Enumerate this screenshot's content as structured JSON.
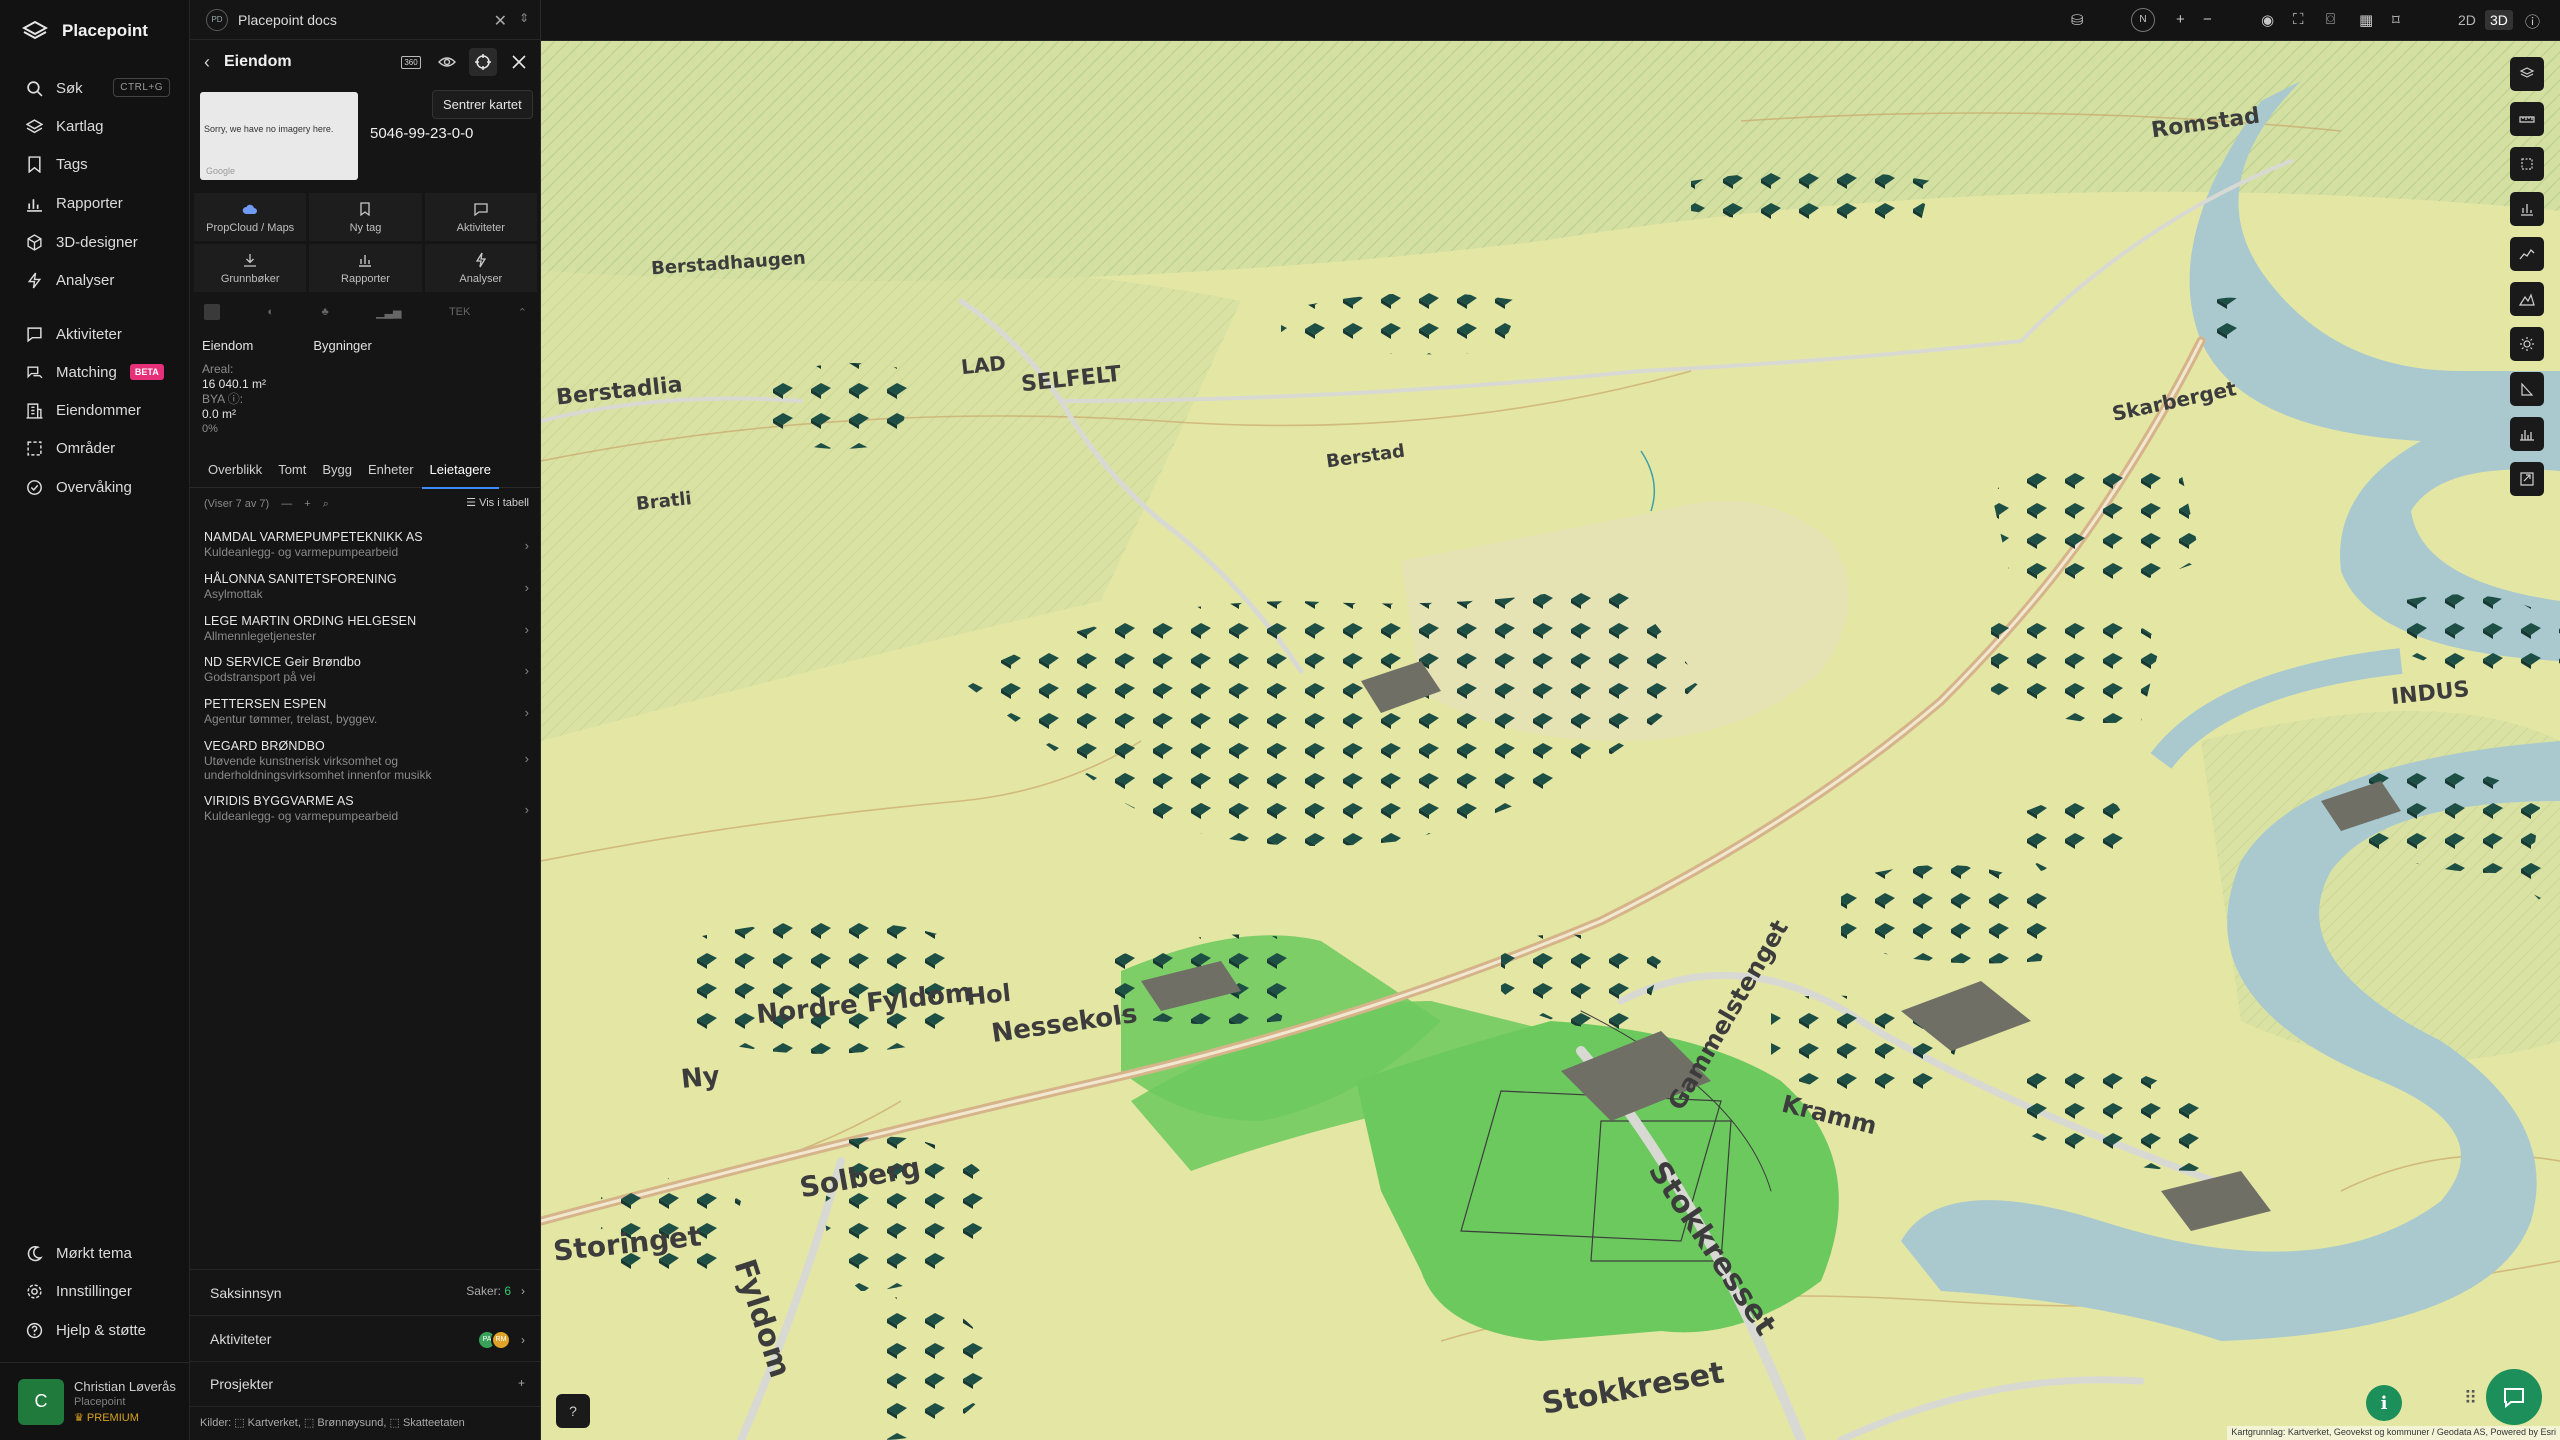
{
  "app": {
    "name": "Placepoint",
    "doc_tab": "Placepoint docs",
    "doc_tab_initials": "PD"
  },
  "nav": {
    "items": [
      {
        "label": "Søk",
        "shortcut": "CTRL+G"
      },
      {
        "label": "Kartlag"
      },
      {
        "label": "Tags"
      },
      {
        "label": "Rapporter"
      },
      {
        "label": "3D-designer"
      },
      {
        "label": "Analyser"
      },
      {
        "label": "Aktiviteter"
      },
      {
        "label": "Matching",
        "badge": "BETA"
      },
      {
        "label": "Eiendommer"
      },
      {
        "label": "Områder"
      },
      {
        "label": "Overvåking"
      }
    ],
    "bottom": [
      {
        "label": "Mørkt tema"
      },
      {
        "label": "Innstillinger"
      },
      {
        "label": "Hjelp & støtte"
      }
    ],
    "user": {
      "initial": "C",
      "name": "Christian Løverås",
      "org": "Placepoint",
      "plan": "PREMIUM"
    }
  },
  "panel": {
    "title": "Eiendom",
    "header_badge": "360",
    "tooltip": "Sentrer kartet",
    "thumb_message": "Sorry, we have no imagery here.",
    "thumb_credit": "Google",
    "parcel_id": "5046-99-23-0-0",
    "actions": [
      {
        "label": "PropCloud / Maps",
        "icon": "cloud-icon"
      },
      {
        "label": "Ny tag",
        "icon": "bookmark-icon"
      },
      {
        "label": "Aktiviteter",
        "icon": "chat-icon"
      },
      {
        "label": "Grunnbøker",
        "icon": "download-icon"
      },
      {
        "label": "Rapporter",
        "icon": "chart-icon"
      },
      {
        "label": "Analyser",
        "icon": "bolt-icon"
      }
    ],
    "layer_icon_text": "TEK",
    "subtabs": [
      "Eiendom",
      "Bygninger"
    ],
    "facts": {
      "area_label": "Areal:",
      "area_value": "16 040.1 m²",
      "bya_label": "BYA ⓘ:",
      "bya_value": "0.0 m²",
      "bya_pct": "0%"
    },
    "tabs": [
      "Overblikk",
      "Tomt",
      "Bygg",
      "Enheter",
      "Leietagere"
    ],
    "active_tab": "Leietagere",
    "list_count": "(Viser 7 av 7)",
    "list_table_btn": "Vis i tabell",
    "tenants": [
      {
        "name": "NAMDAL VARMEPUMPETEKNIKK AS",
        "desc": "Kuldeanlegg- og varmepumpearbeid"
      },
      {
        "name": "HÅLONNA SANITETSFORENING",
        "desc": "Asylmottak"
      },
      {
        "name": "LEGE MARTIN ORDING HELGESEN",
        "desc": "Allmennlegetjenester"
      },
      {
        "name": "ND SERVICE Geir Brøndbo",
        "desc": "Godstransport på vei"
      },
      {
        "name": "PETTERSEN ESPEN",
        "desc": "Agentur tømmer, trelast, byggev."
      },
      {
        "name": "VEGARD BRØNDBO",
        "desc": "Utøvende kunstnerisk virksomhet og underholdningsvirksomhet innenfor musikk"
      },
      {
        "name": "VIRIDIS BYGGVARME AS",
        "desc": "Kuldeanlegg- og varmepumpearbeid"
      }
    ],
    "sections": {
      "saksinnsyn": {
        "label": "Saksinnsyn",
        "count_label": "Saker:",
        "count": "6"
      },
      "aktiviteter": {
        "label": "Aktiviteter",
        "avatars": [
          "PA",
          "RM"
        ]
      },
      "prosjekter": {
        "label": "Prosjekter"
      }
    },
    "sources": "Kilder: ⬚ Kartverket, ⬚ Brønnøysund, ⬚ Skatteetaten"
  },
  "topbar": {
    "mode_2d": "2D",
    "mode_3d": "3D",
    "active_mode": "3D"
  },
  "map": {
    "labels": [
      "Romstad",
      "Berstadhaugen",
      "LAD",
      "SELFELT",
      "Berstadlia",
      "Berstad",
      "Bratli",
      "Skarberget",
      "INDUS",
      "Nordre Fyldom",
      "Hol",
      "Nessekols",
      "Ny",
      "Solberg",
      "Storinget",
      "Fyldom",
      "Stokkresset",
      "Stokkreset",
      "Gammelstenget",
      "Kramm"
    ],
    "attribution": "Kartgrunnlag: Kartverket, Geovekst og kommuner / Geodata AS, Powered by Esri",
    "colors": {
      "land": "#e6e7a6",
      "field": "#6cc95e",
      "river": "#a9c9cf",
      "road": "#d6b48a",
      "building": "#1e4f45"
    }
  },
  "help_label": "?"
}
